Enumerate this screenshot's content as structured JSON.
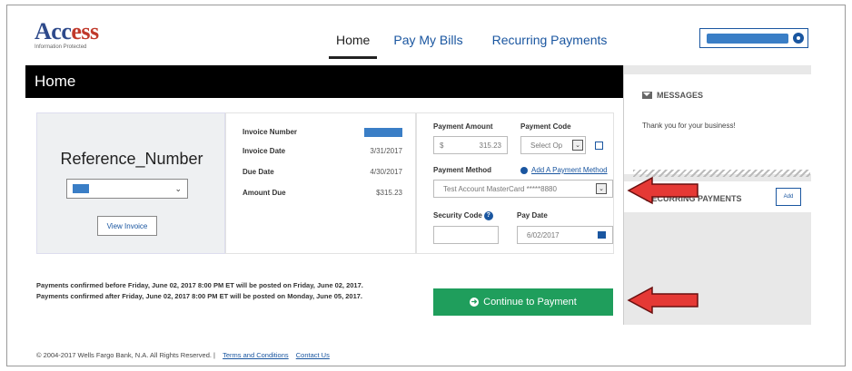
{
  "logo": {
    "word_a": "Acc",
    "word_b": "ess",
    "tagline": "Information Protected"
  },
  "nav": {
    "items": [
      "Home",
      "Pay My Bills",
      "Recurring Payments"
    ]
  },
  "page_title": "Home",
  "reference": {
    "title": "Reference_Number",
    "view_button": "View Invoice",
    "select_chevron": "⌄"
  },
  "invoice": {
    "labels": {
      "number": "Invoice Number",
      "date": "Invoice Date",
      "due": "Due Date",
      "amount": "Amount Due"
    },
    "values": {
      "date": "3/31/2017",
      "due": "4/30/2017",
      "amount": "$315.23"
    }
  },
  "payment": {
    "amount_label": "Payment Amount",
    "currency": "$",
    "amount_value": "315.23",
    "code_label": "Payment Code",
    "code_placeholder": "Select Op",
    "method_label": "Payment Method",
    "add_method": "Add A Payment Method",
    "method_value": "Test Account MasterCard *****8880",
    "security_label": "Security Code",
    "date_label": "Pay Date",
    "date_value": "6/02/2017"
  },
  "messages": {
    "title": "MESSAGES",
    "text": "Thank you for your business!"
  },
  "recurring": {
    "title": "RECURRING PAYMENTS",
    "add": "Add"
  },
  "notes": {
    "line1": "Payments confirmed before Friday, June 02, 2017 8:00 PM ET will be posted on Friday, June 02, 2017.",
    "line2": "Payments confirmed after Friday, June 02, 2017 8:00 PM ET will be posted on Monday, June 05, 2017."
  },
  "continue_label": "Continue to Payment",
  "footer": {
    "copyright": "© 2004-2017 Wells Fargo Bank, N.A. All Rights Reserved. |",
    "terms": "Terms and Conditions",
    "contact": "Contact Us"
  },
  "colors": {
    "brand_red": "#c0392b",
    "brand_blue": "#2e4a8b",
    "link": "#1a56a0",
    "continue": "#1f9e5c",
    "arrow": "#e53935"
  }
}
